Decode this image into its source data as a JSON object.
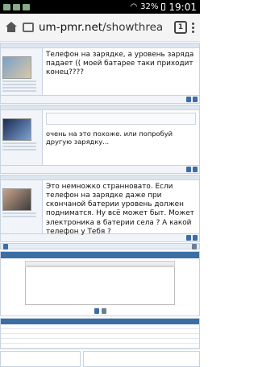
{
  "status": {
    "battery": "32%",
    "time": "19:01"
  },
  "browser": {
    "url_main": "um-pmr.net",
    "url_rest": "/showthrea",
    "tab_count": "1"
  },
  "posts": [
    {
      "text": "Телефон на зарядке, а уровень заряда падает (( моей батарее таки приходит конец????"
    },
    {
      "text": "очень на это похоже. или попробуй другую зарядку..."
    },
    {
      "text": "Это немножко странновато. Если телефон на зарядке даже при скончаной батерии уровень должен подниматся. Ну всё может быт. Может электроника в батерии села ? А какой телефон у Тебя ?"
    }
  ]
}
